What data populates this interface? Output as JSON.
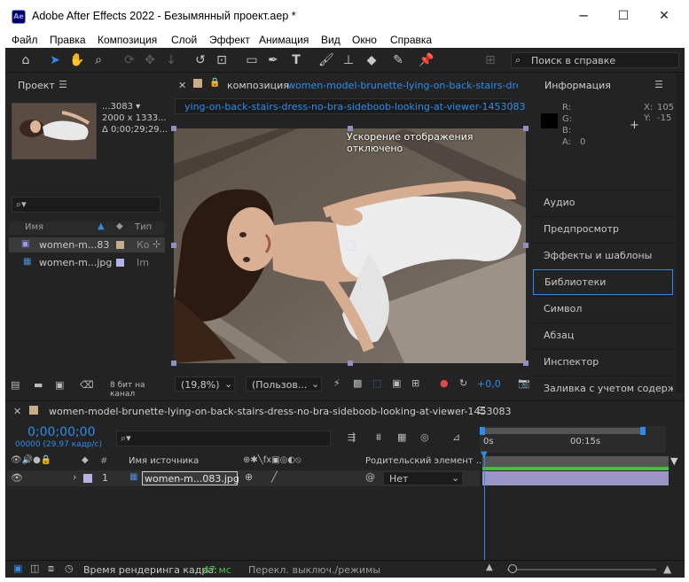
{
  "window": {
    "app_icon_text": "Ae",
    "title": "Adobe After Effects 2022 - Безымянный проект.aep *",
    "minimize": "─",
    "maximize": "☐",
    "close": "✕"
  },
  "menu": [
    "Файл",
    "Правка",
    "Композиция",
    "Слой",
    "Эффект",
    "Анимация",
    "Вид",
    "Окно",
    "Справка"
  ],
  "toolbar": {
    "help_placeholder": "Поиск в справке"
  },
  "project": {
    "title": "Проект",
    "thumb_name": "...3083 ▾",
    "thumb_size": "2000 x 1333...",
    "thumb_duration": "Δ 0;00;29;29...",
    "col_name": "Имя",
    "col_type": "Тип",
    "items": [
      {
        "name": "women-m...83",
        "type": "Ко",
        "color": "#c7ad8a",
        "icon": "composition-icon",
        "selected": true
      },
      {
        "name": "women-m...jpg",
        "type": "Im",
        "color": "#b3b3e6",
        "icon": "image-file-icon",
        "selected": false
      }
    ],
    "bpc": "8 бит на канал"
  },
  "composition": {
    "tab_prefix": "композиция",
    "tab_name": "women-model-brunette-lying-on-back-stairs-dress-",
    "breadcrumb": "ying-on-back-stairs-dress-no-bra-sideboob-looking-at-viewer-1453083",
    "accel_notice": "Ускорение отображения отключено",
    "zoom": "(19,8%)",
    "resolution": "(Пользов...",
    "exposure": "+0,0"
  },
  "info": {
    "title": "Информация",
    "r": "R:",
    "g": "G:",
    "b": "B:",
    "a": "A:",
    "a_value": "0",
    "x": "X:",
    "x_value": "105",
    "y": "Y:",
    "y_value": "-15"
  },
  "right_panels": [
    "Аудио",
    "Предпросмотр",
    "Эффекты и шаблоны",
    "Библиотеки",
    "Символ",
    "Абзац",
    "Инспектор",
    "Заливка с учетом содержи"
  ],
  "right_panels_selected": 3,
  "timeline": {
    "comp_name": "women-model-brunette-lying-on-back-stairs-dress-no-bra-sideboob-looking-at-viewer-1453083",
    "timecode": "0;00;00;00",
    "frames": "00000 (29.97 кадр/с)",
    "col_num": "#",
    "col_source": "Имя источника",
    "col_parent": "Родительский элемент ...",
    "ruler_0": "0s",
    "ruler_15": "00:15s",
    "layer": {
      "num": "1",
      "name": "women-m...083.jpg",
      "parent": "Нет",
      "color": "#b3b3e6"
    }
  },
  "status": {
    "render_label": "Время рендеринга кадра:",
    "render_value": "47 мс",
    "toggle_modes": "Перекл. выключ./режимы"
  },
  "colors": {
    "accent": "#2d8ceb",
    "panel_bg": "#232323",
    "green_bar": "#3ec23e"
  }
}
